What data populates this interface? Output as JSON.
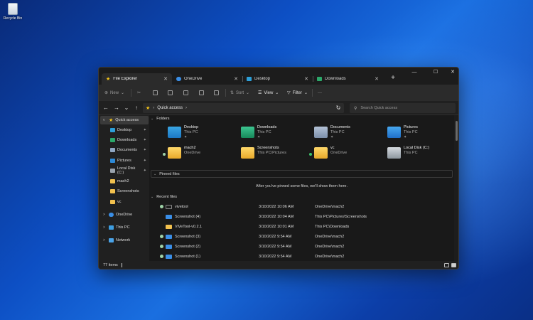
{
  "desktop": {
    "recycle_bin_label": "Recycle Bin"
  },
  "window": {
    "tabs": [
      {
        "label": "File Explorer",
        "icon": "star-icon",
        "active": true
      },
      {
        "label": "OneDrive",
        "icon": "cloud-icon",
        "active": false
      },
      {
        "label": "Desktop",
        "icon": "desktop-icon",
        "active": false
      },
      {
        "label": "Downloads",
        "icon": "download-icon",
        "active": false
      }
    ],
    "new_tab": "+",
    "controls": {
      "minimize": "—",
      "maximize": "☐",
      "close": "✕"
    }
  },
  "toolbar": {
    "new_label": "New",
    "sort_label": "Sort",
    "view_label": "View",
    "filter_label": "Filter",
    "more_label": "···"
  },
  "address": {
    "location": "Quick access",
    "search_placeholder": "Search Quick access"
  },
  "sidebar": {
    "items": [
      {
        "label": "Quick access",
        "icon": "star-icon",
        "pinned": false,
        "selected": true,
        "expander": "v"
      },
      {
        "label": "Desktop",
        "icon": "desktop-folder-icon",
        "pinned": true
      },
      {
        "label": "Downloads",
        "icon": "downloads-folder-icon",
        "pinned": true
      },
      {
        "label": "Documents",
        "icon": "documents-folder-icon",
        "pinned": true
      },
      {
        "label": "Pictures",
        "icon": "pictures-folder-icon",
        "pinned": true
      },
      {
        "label": "Local Disk (C:)",
        "icon": "drive-icon",
        "pinned": true
      },
      {
        "label": "mach2",
        "icon": "folder-icon",
        "pinned": false
      },
      {
        "label": "Screenshots",
        "icon": "folder-icon",
        "pinned": false
      },
      {
        "label": "vc",
        "icon": "folder-icon",
        "pinned": false
      },
      {
        "label": "OneDrive",
        "icon": "cloud-icon",
        "expander": ">"
      },
      {
        "label": "This PC",
        "icon": "pc-icon",
        "expander": ">"
      },
      {
        "label": "Network",
        "icon": "network-icon",
        "expander": ">"
      }
    ]
  },
  "folders_section": {
    "title": "Folders",
    "items": [
      {
        "name": "Desktop",
        "location": "This PC",
        "pinned": true
      },
      {
        "name": "Downloads",
        "location": "This PC",
        "pinned": true
      },
      {
        "name": "Documents",
        "location": "This PC",
        "pinned": true
      },
      {
        "name": "Pictures",
        "location": "This PC",
        "pinned": true
      },
      {
        "name": "mach2",
        "location": "OneDrive",
        "pinned": false
      },
      {
        "name": "Screenshots",
        "location": "This PC\\Pictures",
        "pinned": false
      },
      {
        "name": "vc",
        "location": "OneDrive",
        "pinned": false
      },
      {
        "name": "Local Disk (C:)",
        "location": "This PC",
        "pinned": false
      }
    ]
  },
  "pinned_section": {
    "title": "Pinned files",
    "empty_message": "After you've pinned some files, we'll show them here."
  },
  "recent_section": {
    "title": "Recent files",
    "rows": [
      {
        "name": "vivetool",
        "date": "3/10/2022 10:06 AM",
        "location": "OneDrive\\mach2"
      },
      {
        "name": "Screenshot (4)",
        "date": "3/10/2022 10:04 AM",
        "location": "This PC\\Pictures\\Screenshots"
      },
      {
        "name": "ViVeTool-v0.2.1",
        "date": "3/10/2022 10:01 AM",
        "location": "This PC\\Downloads"
      },
      {
        "name": "Screenshot (3)",
        "date": "3/10/2022 9:54 AM",
        "location": "OneDrive\\mach2"
      },
      {
        "name": "Screenshot (2)",
        "date": "3/10/2022 9:54 AM",
        "location": "OneDrive\\mach2"
      },
      {
        "name": "Screenshot (1)",
        "date": "3/10/2022 9:54 AM",
        "location": "OneDrive\\mach2"
      }
    ]
  },
  "status": {
    "item_count": "77 items"
  },
  "glyphs": {
    "pin": "📌"
  }
}
